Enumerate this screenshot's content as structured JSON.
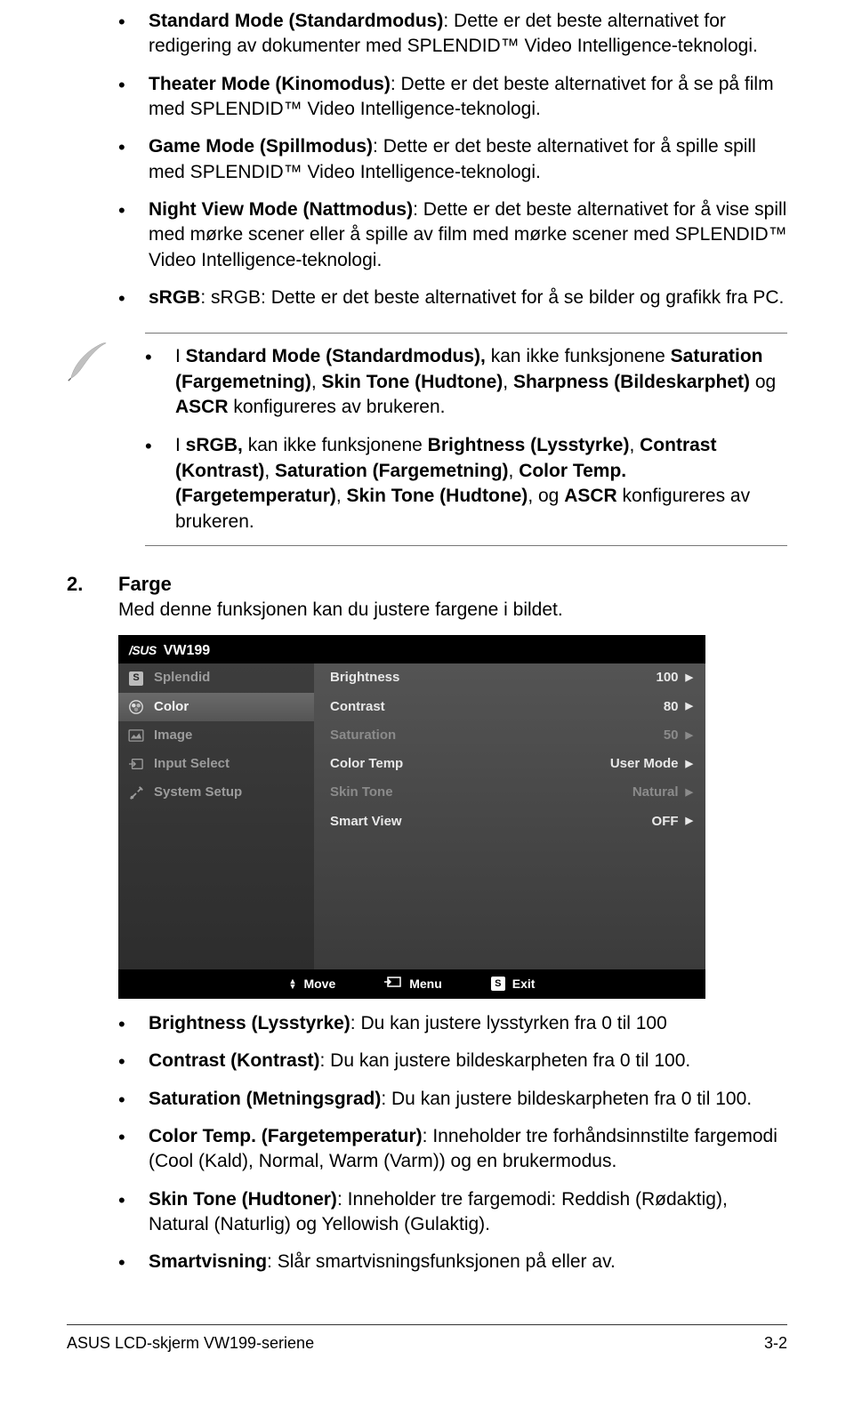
{
  "bullets": [
    {
      "b": "Standard Mode (Standardmodus)",
      "t": ": Dette er det beste alternativet for redigering av dokumenter med SPLENDID™ Video Intelligence-teknologi."
    },
    {
      "b": "Theater Mode (Kinomodus)",
      "t": ": Dette er det beste alternativet for å se på film med SPLENDID™ Video Intelligence-teknologi."
    },
    {
      "b": "Game Mode (Spillmodus)",
      "t": ": Dette er det beste alternativet for å spille spill med SPLENDID™ Video Intelligence-teknologi."
    },
    {
      "b": "Night View Mode (Nattmodus)",
      "t": ": Dette er det beste alternativet for å vise spill med mørke scener eller å spille av film med mørke scener med SPLENDID™ Video Intelligence-teknologi."
    },
    {
      "b": "sRGB",
      "t": ": sRGB: Dette er det beste alternativet for å se bilder og grafikk fra PC."
    }
  ],
  "notes": [
    "I <b>Standard Mode (Standardmodus),</b> kan ikke funksjonene <b>Saturation (Fargemetning)</b>, <b>Skin Tone (Hudtone)</b>, <b>Sharpness (Bildeskarphet)</b> og <b>ASCR</b> konfigureres av brukeren.",
    "I <b>sRGB,</b> kan ikke funksjonene <b>Brightness (Lysstyrke)</b>, <b>Contrast (Kontrast)</b>, <b>Saturation (Fargemetning)</b>, <b>Color Temp. (Fargetemperatur)</b>, <b>Skin Tone (Hudtone)</b>, og <b>ASCR</b> konfigureres av brukeren."
  ],
  "section": {
    "num": "2.",
    "title": "Farge",
    "intro": "Med denne funksjonen kan du justere fargene i bildet."
  },
  "osd": {
    "model": "VW199",
    "left": [
      {
        "label": "Splendid",
        "icon": "S",
        "active": false
      },
      {
        "label": "Color",
        "icon": "color",
        "active": true
      },
      {
        "label": "Image",
        "icon": "image",
        "active": false
      },
      {
        "label": "Input Select",
        "icon": "input",
        "active": false
      },
      {
        "label": "System Setup",
        "icon": "tools",
        "active": false
      }
    ],
    "right": [
      {
        "label": "Brightness",
        "value": "100",
        "dim": false
      },
      {
        "label": "Contrast",
        "value": "80",
        "dim": false
      },
      {
        "label": "Saturation",
        "value": "50",
        "dim": true
      },
      {
        "label": "Color Temp",
        "value": "User Mode",
        "dim": false
      },
      {
        "label": "Skin Tone",
        "value": "Natural",
        "dim": true
      },
      {
        "label": "Smart View",
        "value": "OFF",
        "dim": false
      }
    ],
    "footer": {
      "move": "Move",
      "menu": "Menu",
      "exit": "Exit"
    }
  },
  "bullets2": [
    {
      "b": "Brightness (Lysstyrke)",
      "t": ": Du kan justere lysstyrken fra 0 til 100"
    },
    {
      "b": "Contrast (Kontrast)",
      "t": ": Du kan justere bildeskarpheten fra 0 til 100."
    },
    {
      "b": "Saturation (Metningsgrad)",
      "t": ": Du kan justere bildeskarpheten fra 0 til 100."
    },
    {
      "b": "Color Temp. (Fargetemperatur)",
      "t": ": Inneholder tre forhåndsinnstilte fargemodi (Cool (Kald), Normal, Warm (Varm)) og en brukermodus."
    },
    {
      "b": "Skin Tone (Hudtoner)",
      "t": ": Inneholder tre fargemodi: Reddish (Rødaktig), Natural (Naturlig) og Yellowish (Gulaktig)."
    },
    {
      "b": "Smartvisning",
      "t": ": Slår smartvisningsfunksjonen på eller av."
    }
  ],
  "footer": {
    "left": "ASUS LCD-skjerm VW199-seriene",
    "right": "3-2"
  }
}
